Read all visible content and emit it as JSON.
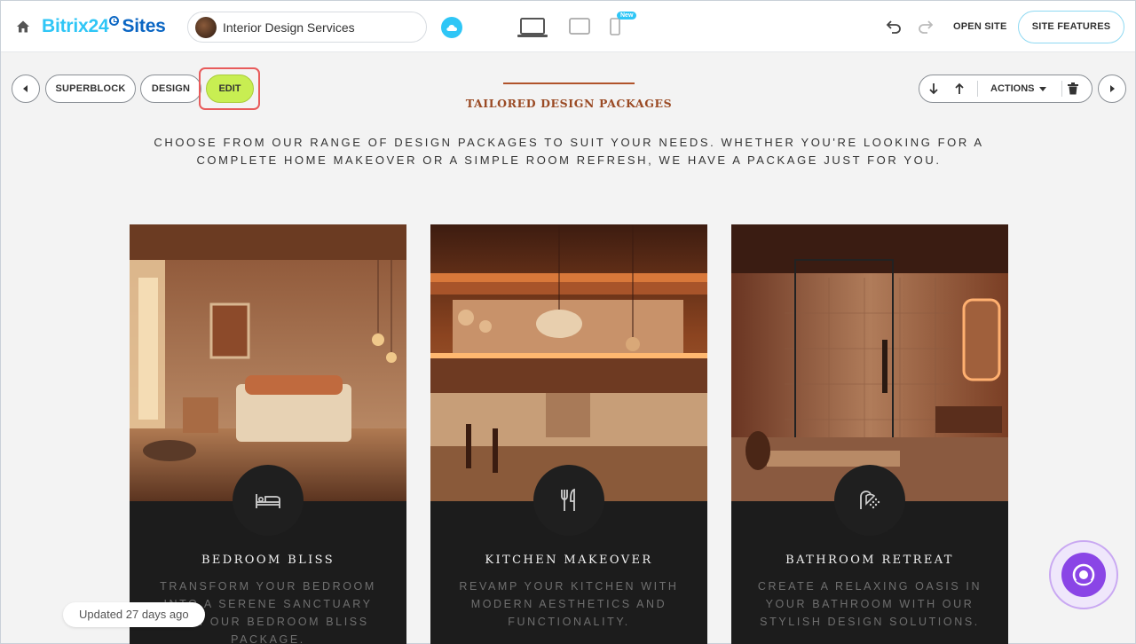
{
  "topbar": {
    "brand_part1": "Bitrix24",
    "brand_part2": "Sites",
    "site_name": "Interior Design Services",
    "new_badge": "New",
    "open_site": "OPEN SITE",
    "site_features": "SITE FEATURES"
  },
  "block_toolbar": {
    "superblock": "SUPERBLOCK",
    "design": "DESIGN",
    "edit": "EDIT",
    "actions": "ACTIONS"
  },
  "content": {
    "title": "TAILORED DESIGN PACKAGES",
    "description": "CHOOSE FROM OUR RANGE OF DESIGN PACKAGES TO SUIT YOUR NEEDS. WHETHER YOU'RE LOOKING FOR A COMPLETE HOME MAKEOVER OR A SIMPLE ROOM REFRESH, WE HAVE A PACKAGE JUST FOR YOU.",
    "cards": [
      {
        "title": "BEDROOM BLISS",
        "text": "TRANSFORM YOUR BEDROOM INTO A SERENE SANCTUARY WITH OUR BEDROOM BLISS PACKAGE.",
        "icon": "bed-icon"
      },
      {
        "title": "KITCHEN MAKEOVER",
        "text": "REVAMP YOUR KITCHEN WITH MODERN AESTHETICS AND FUNCTIONALITY.",
        "icon": "utensils-icon"
      },
      {
        "title": "BATHROOM RETREAT",
        "text": "CREATE A RELAXING OASIS IN YOUR BATHROOM WITH OUR STYLISH DESIGN SOLUTIONS.",
        "icon": "shower-icon"
      }
    ]
  },
  "footer": {
    "updated": "Updated 27 days ago"
  },
  "colors": {
    "accent_blue": "#2fc6f6",
    "edit_green": "#c8ee52",
    "title_brown": "#9a4a24",
    "card_bg": "#1c1c1c"
  }
}
